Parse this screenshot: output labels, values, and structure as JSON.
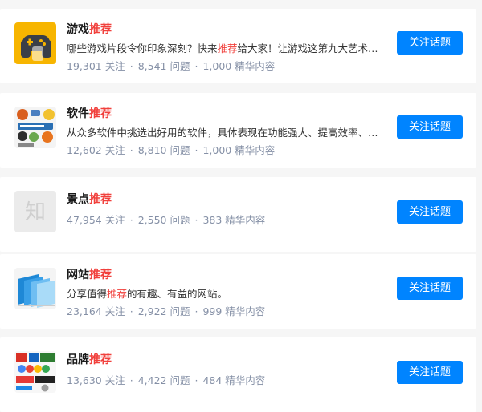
{
  "topics": [
    {
      "title_plain": "游戏",
      "title_highlight": "推荐",
      "desc_before": "哪些游戏片段令你印象深刻？快来",
      "desc_highlight": "推荐",
      "desc_after": "给大家！让游戏这第九大艺术，在…",
      "followers": "19,301 关注",
      "questions": "8,541 问题",
      "featured": "1,000 精华内容",
      "button": "关注话题",
      "icon": "gamepad-icon"
    },
    {
      "title_plain": "软件",
      "title_highlight": "推荐",
      "desc_before": "从众多软件中挑选出好用的软件，具体表现在功能强大、提高效率、更好…",
      "desc_highlight": "",
      "desc_after": "",
      "followers": "12,602 关注",
      "questions": "8,810 问题",
      "featured": "1,000 精华内容",
      "button": "关注话题",
      "icon": "software-logos-icon"
    },
    {
      "title_plain": "景点",
      "title_highlight": "推荐",
      "followers": "47,954 关注",
      "questions": "2,550 问题",
      "featured": "383 精华内容",
      "button": "关注话题",
      "icon": "zhi-placeholder-icon",
      "icon_text": "知"
    },
    {
      "title_plain": "网站",
      "title_highlight": "推荐",
      "desc_before": "分享值得",
      "desc_highlight": "推荐",
      "desc_after": "的有趣、有益的网站。",
      "followers": "23,164 关注",
      "questions": "2,922 问题",
      "featured": "999 精华内容",
      "button": "关注话题",
      "icon": "web-pages-icon"
    },
    {
      "title_plain": "品牌",
      "title_highlight": "推荐",
      "followers": "13,630 关注",
      "questions": "4,422 问题",
      "featured": "484 精华内容",
      "button": "关注话题",
      "icon": "brand-logos-icon"
    }
  ],
  "separator": "·",
  "colors": {
    "accent": "#0084ff",
    "highlight": "#f1403c",
    "meta": "#8590a6",
    "background": "#f6f6f6"
  }
}
